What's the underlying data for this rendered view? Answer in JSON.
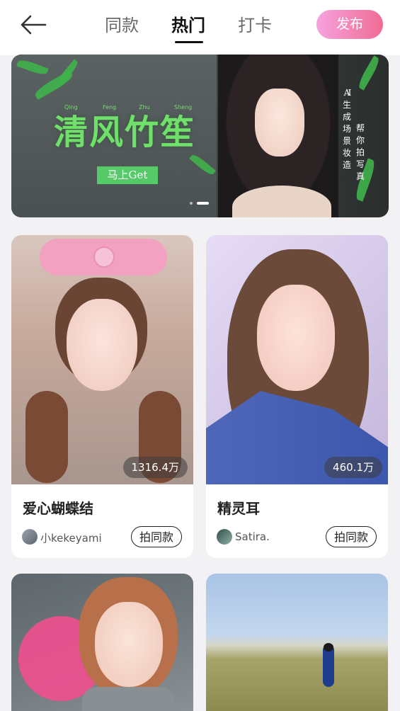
{
  "nav": {
    "tabs": [
      {
        "label": "同款"
      },
      {
        "label": "热门"
      },
      {
        "label": "打卡"
      }
    ],
    "active_tab": "热门",
    "publish_label": "发布"
  },
  "banner": {
    "title": "清风竹笙",
    "pinyin": [
      "Qing",
      "Feng",
      "Zhu",
      "Sheng"
    ],
    "cta_label": "马上Get",
    "side_text_left": [
      "A",
      "I",
      "生",
      "成",
      "场",
      "景",
      "妆",
      "造"
    ],
    "side_text_right": [
      "帮",
      "你",
      "拍",
      "写",
      "真"
    ],
    "page_index": 2,
    "page_count": 2
  },
  "cards": [
    {
      "title": "爱心蝴蝶结",
      "author": "小kekeyami",
      "views": "1316.4万",
      "action_label": "拍同款"
    },
    {
      "title": "精灵耳",
      "author": "Satira.",
      "views": "460.1万",
      "action_label": "拍同款"
    },
    {
      "title": "",
      "author": "",
      "views": "",
      "action_label": ""
    },
    {
      "title": "",
      "author": "",
      "views": "",
      "action_label": ""
    }
  ],
  "colors": {
    "publish_gradient_start": "#f6a3df",
    "publish_gradient_end": "#f06c93",
    "banner_title": "#6fe06a",
    "banner_cta": "#56c968"
  },
  "icons": {
    "back": "arrow-left-icon"
  }
}
